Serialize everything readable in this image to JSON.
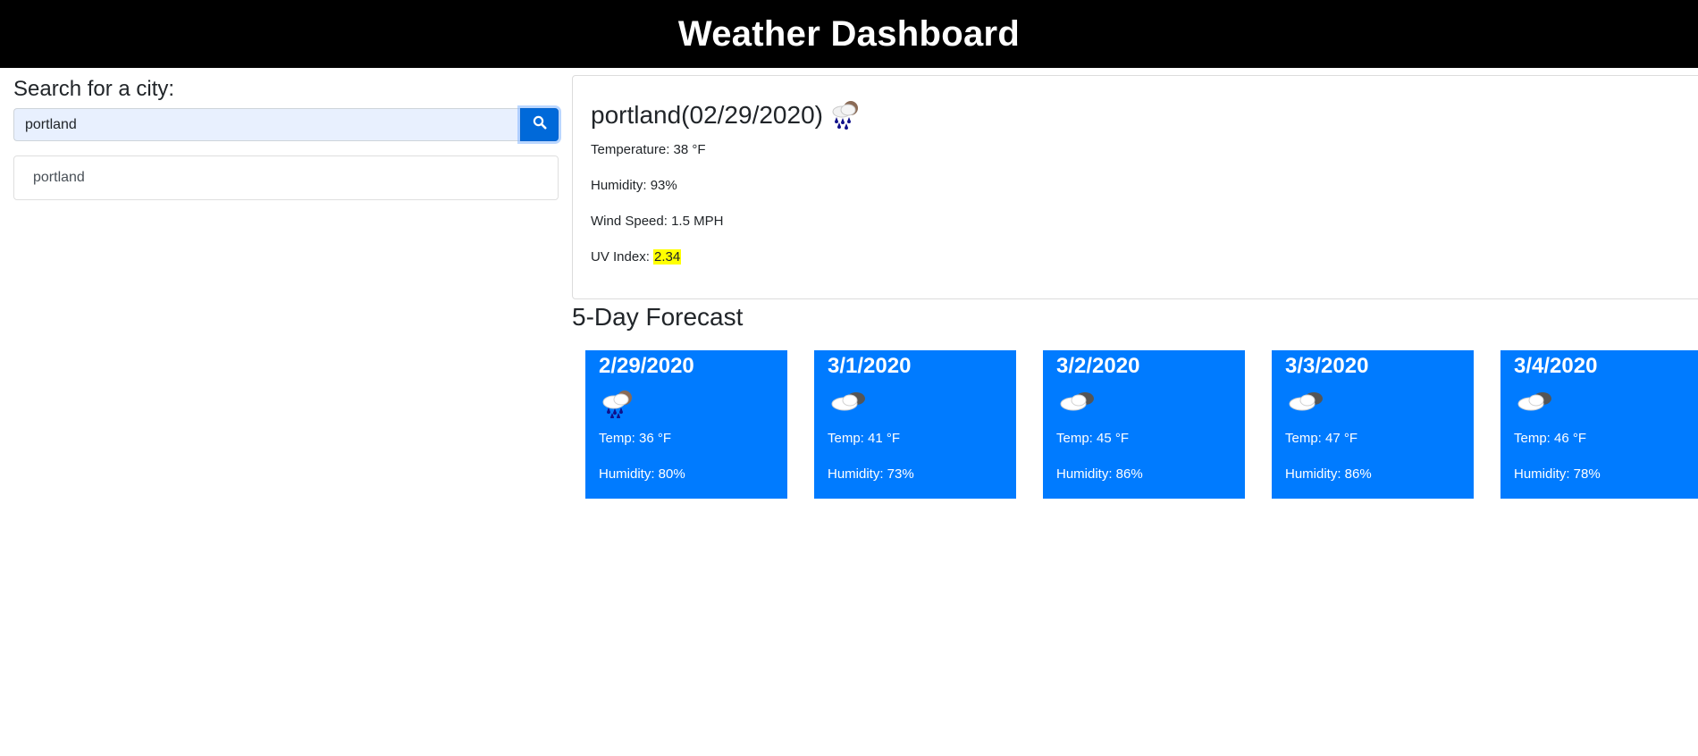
{
  "header": {
    "title": "Weather Dashboard"
  },
  "search": {
    "label": "Search for a city:",
    "value": "portland",
    "button_icon": "search-icon"
  },
  "history": [
    {
      "city": "portland"
    }
  ],
  "current": {
    "title": "portland(02/29/2020)",
    "icon": "rain-cloud-icon",
    "temperature_label": "Temperature: ",
    "temperature": "38 °F",
    "humidity_label": "Humidity: ",
    "humidity": "93%",
    "wind_label": "Wind Speed: ",
    "wind": "1.5 MPH",
    "uv_label": "UV Index: ",
    "uv": "2.34",
    "uv_color": "#ffff00"
  },
  "forecast": {
    "heading": "5-Day Forecast",
    "card_color": "#007bff",
    "days": [
      {
        "date": "2/29/2020",
        "icon": "rain-cloud-icon",
        "temp": "Temp: 36 °F",
        "humidity": "Humidity: 80%"
      },
      {
        "date": "3/1/2020",
        "icon": "cloudy-icon",
        "temp": "Temp: 41 °F",
        "humidity": "Humidity: 73%"
      },
      {
        "date": "3/2/2020",
        "icon": "cloudy-icon",
        "temp": "Temp: 45 °F",
        "humidity": "Humidity: 86%"
      },
      {
        "date": "3/3/2020",
        "icon": "cloudy-icon",
        "temp": "Temp: 47 °F",
        "humidity": "Humidity: 86%"
      },
      {
        "date": "3/4/2020",
        "icon": "cloudy-icon",
        "temp": "Temp: 46 °F",
        "humidity": "Humidity: 78%"
      }
    ]
  }
}
